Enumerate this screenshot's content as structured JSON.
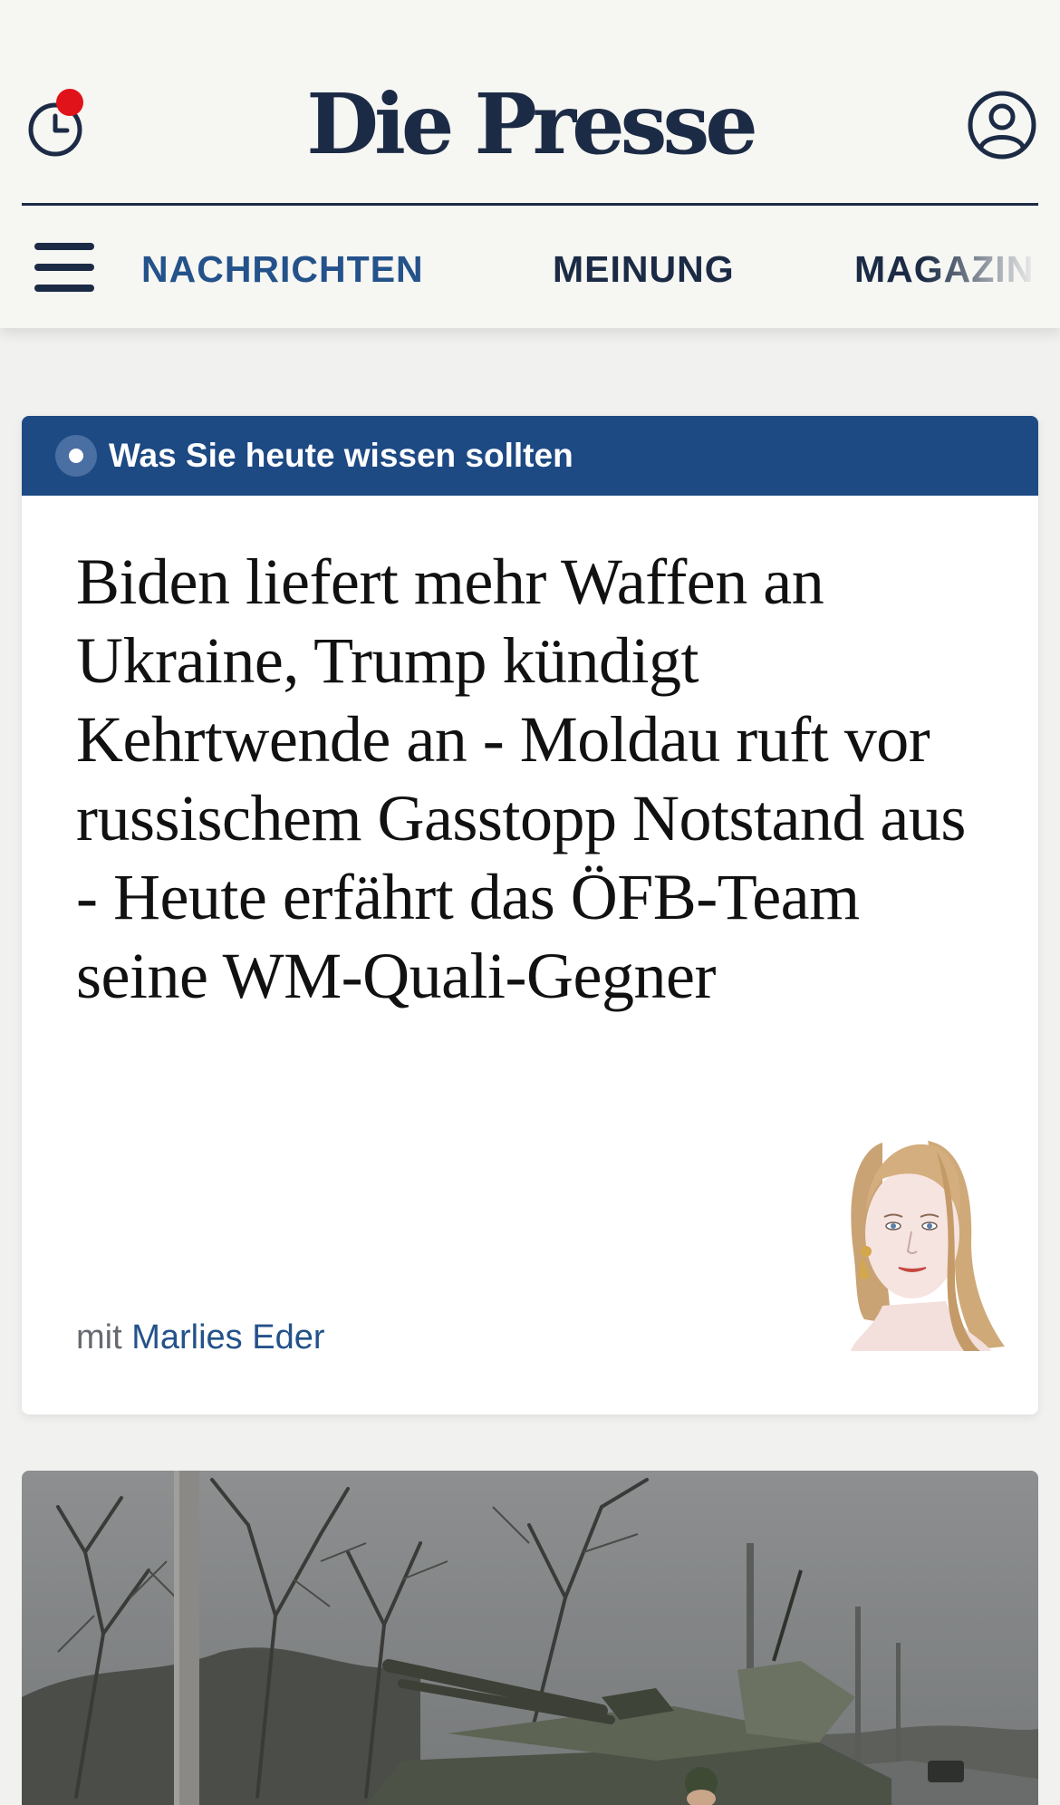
{
  "header": {
    "logo": "Die Presse",
    "history_icon": "clock-history-icon",
    "history_has_notification": true,
    "account_icon": "user-account-icon",
    "nav": {
      "menu_icon": "hamburger-menu-icon",
      "items": [
        {
          "label": "NACHRICHTEN",
          "active": true
        },
        {
          "label": "MEINUNG",
          "active": false
        },
        {
          "label": "MAGAZIN",
          "active": false
        }
      ]
    }
  },
  "briefing": {
    "label": "Was Sie heute wissen sollten",
    "headline": "Biden liefert mehr Waffen an Ukraine, Trump kündigt Kehrtwende an - Moldau ruft vor russischem Gasstopp Notstand aus - Heute erfährt das ÖFB-Team seine WM-Quali-Gegner",
    "byline_prefix": "mit",
    "author": "Marlies Eder",
    "author_image": "author-portrait-illustration"
  },
  "teaser": {
    "image": "military-vehicle-on-road-photo"
  },
  "colors": {
    "brand_navy": "#1c2b45",
    "accent_blue": "#1e4a84",
    "link_blue": "#24528a",
    "notification_red": "#e1131a",
    "page_background": "#f1f1ef"
  }
}
